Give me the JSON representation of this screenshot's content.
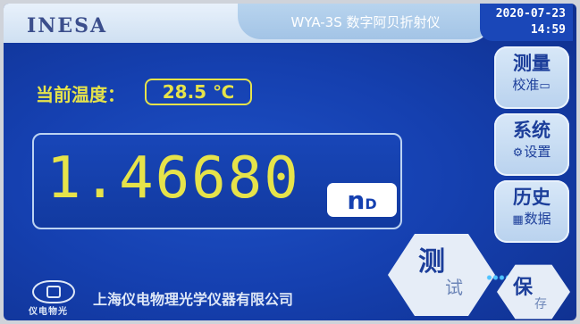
{
  "header": {
    "logo": "INESA",
    "model": "WYA-3S 数字阿贝折射仪",
    "date": "2020-07-23",
    "time": "14:59"
  },
  "temperature": {
    "label": "当前温度：",
    "value": "28.5 ℃"
  },
  "reading": {
    "value": "1.46680",
    "unit_main": "n",
    "unit_sub": "D"
  },
  "side_buttons": [
    {
      "title": "测量",
      "subtitle": "校准",
      "icon": "monitor-icon"
    },
    {
      "title": "系统",
      "subtitle": "设置",
      "icon": "gear-icon"
    },
    {
      "title": "历史",
      "subtitle": "数据",
      "icon": "grid-icon"
    }
  ],
  "actions": {
    "test_a": "测",
    "test_b": "试",
    "save_a": "保",
    "save_b": "存"
  },
  "footer": {
    "logo_text": "仪电物光",
    "company": "上海仪电物理光学仪器有限公司"
  },
  "colors": {
    "screen_bg": "#1540b0",
    "accent_yellow": "#e6e34a",
    "button_bg": "#d8e8f8"
  }
}
